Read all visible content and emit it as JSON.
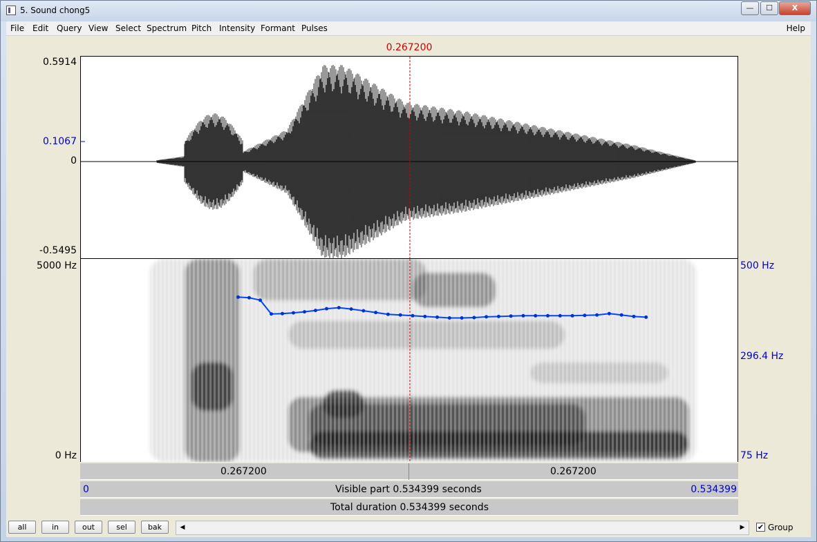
{
  "window": {
    "title": "5. Sound chong5",
    "buttons": {
      "minimize": "—",
      "maximize": "☐",
      "close": "X"
    }
  },
  "menu": {
    "items": [
      "File",
      "Edit",
      "Query",
      "View",
      "Select",
      "Spectrum",
      "Pitch",
      "Intensity",
      "Formant",
      "Pulses"
    ],
    "help": "Help"
  },
  "cursor": {
    "time_label": "0.267200",
    "time": 0.2672
  },
  "waveform": {
    "y_max": "0.5914",
    "y_cursor": "0.1067",
    "y_zero": "0",
    "y_min": "-0.5495"
  },
  "spectrogram": {
    "freq_max": "5000 Hz",
    "freq_min": "0 Hz",
    "pitch_max": "500 Hz",
    "pitch_cursor": "296.4 Hz",
    "pitch_min": "75 Hz"
  },
  "chart_data": {
    "type": "line",
    "series": [
      {
        "x": [
          0.128,
          0.137,
          0.146,
          0.155,
          0.164,
          0.173,
          0.182,
          0.191,
          0.2,
          0.21,
          0.22,
          0.23,
          0.24,
          0.25,
          0.26,
          0.27,
          0.28,
          0.29,
          0.3,
          0.31,
          0.32,
          0.33,
          0.34,
          0.35,
          0.36,
          0.37,
          0.38,
          0.39,
          0.4,
          0.41,
          0.42,
          0.43,
          0.44,
          0.45,
          0.46
        ],
        "y": [
          350,
          348,
          340,
          299,
          300,
          302,
          305,
          309,
          314,
          317,
          313,
          308,
          303,
          298,
          296,
          294,
          292,
          290,
          288,
          288,
          289,
          291,
          292,
          293,
          294,
          294,
          294,
          294,
          294,
          295,
          296,
          300,
          296,
          292,
          290
        ]
      }
    ],
    "ylim": [
      75,
      500
    ]
  },
  "timebar1": {
    "left_label": "0.267200",
    "right_label": "0.267200"
  },
  "timebar2": {
    "start": "0",
    "text": "Visible part 0.534399 seconds",
    "end": "0.534399"
  },
  "timebar3": {
    "text": "Total duration 0.534399 seconds"
  },
  "buttons": {
    "all": "all",
    "in": "in",
    "out": "out",
    "sel": "sel",
    "bak": "bak"
  },
  "scroll": {
    "left": "◀",
    "right": "▶"
  },
  "group": {
    "label": "Group",
    "checked": "✔"
  }
}
